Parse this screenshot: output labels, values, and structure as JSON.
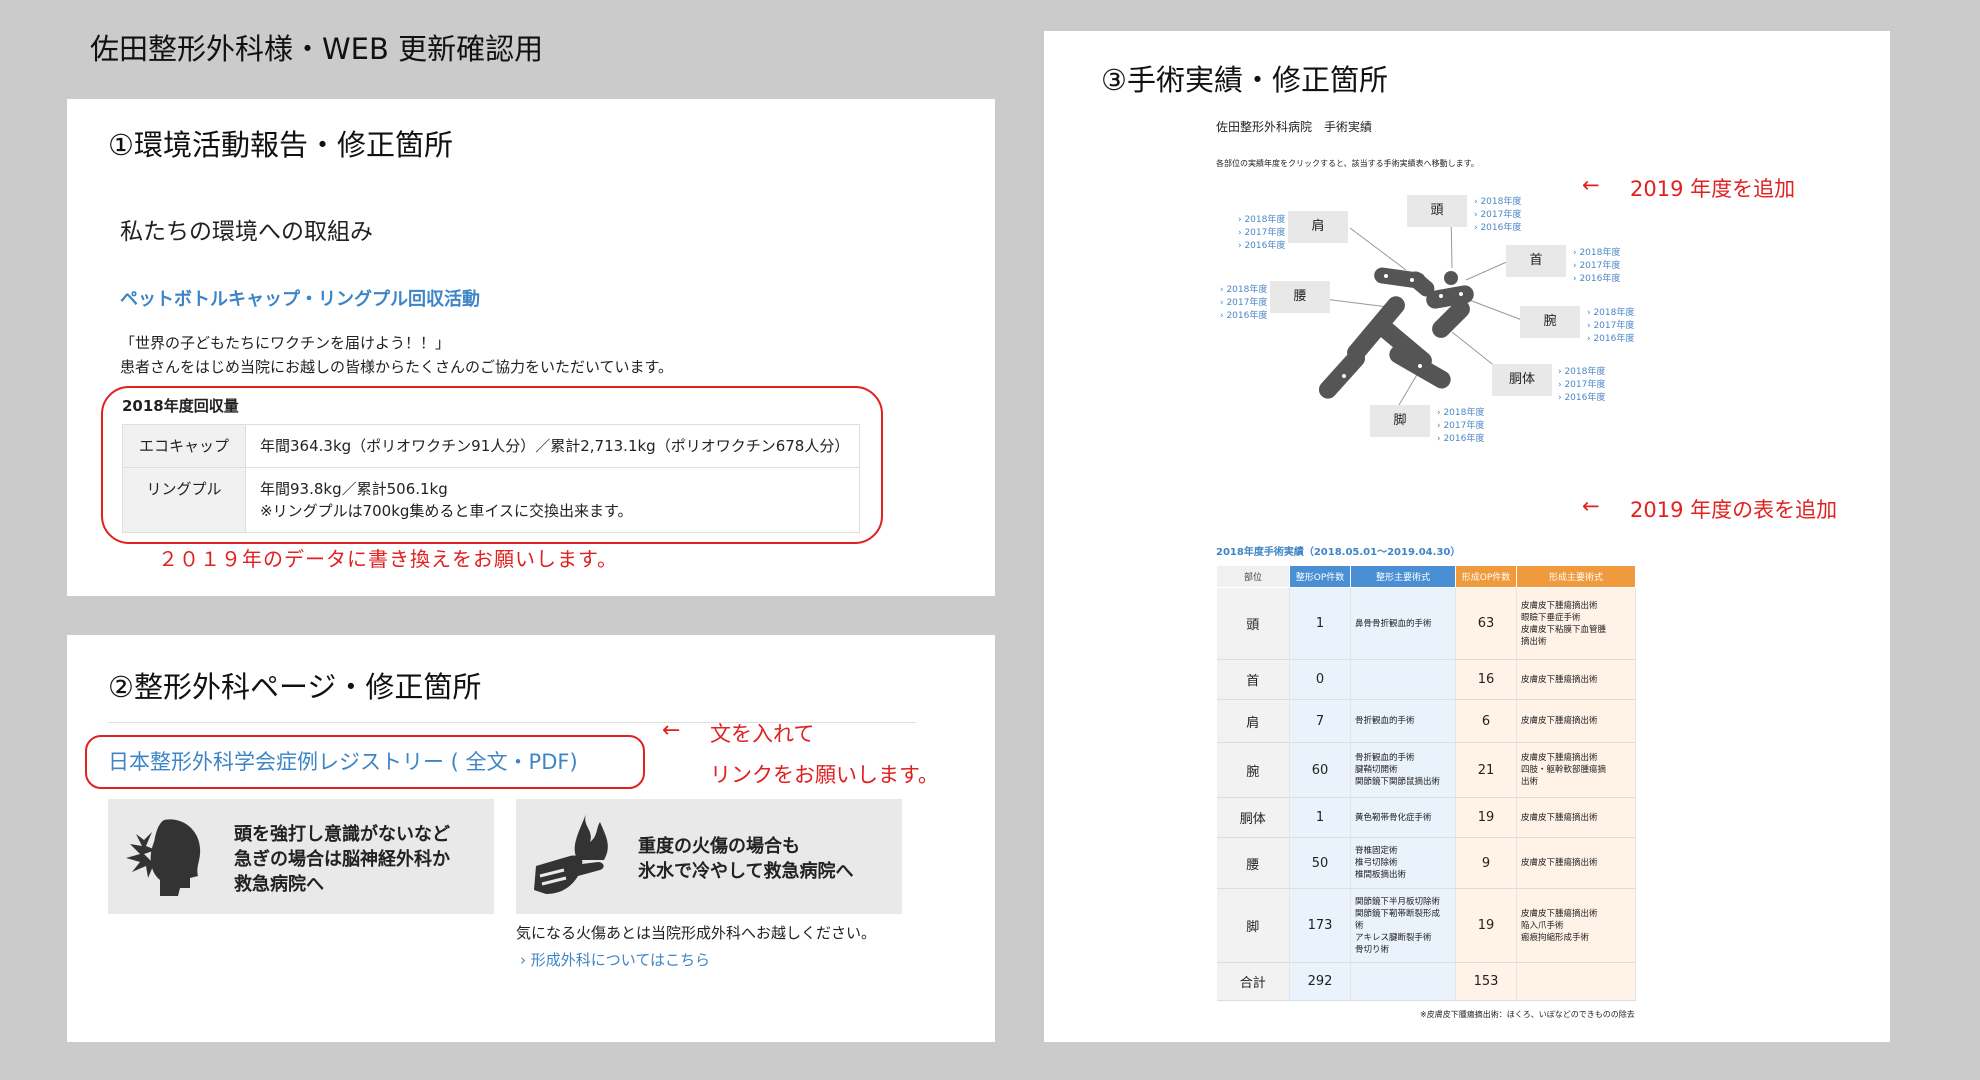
{
  "page_title": "佐田整形外科様・WEB 更新確認用",
  "panel1": {
    "heading": "①環境活動報告・修正箇所",
    "section_title": "私たちの環境への取組み",
    "subheading": "ペットボトルキャップ・リングプル回収活動",
    "intro": [
      "「世界の子どもたちにワクチンを届けよう！！」",
      "患者さんをはじめ当院にお越しの皆様からたくさんのご協力をいただいています。"
    ],
    "table_title": "2018年度回収量",
    "rows": [
      {
        "label": "エコキャップ",
        "lines": [
          "年間364.3kg（ポリオワクチン91人分）／累計2,713.1kg（ポリオワクチン678人分）"
        ]
      },
      {
        "label": "リングプル",
        "lines": [
          "年間93.8kg／累計506.1kg",
          "※リングプルは700kg集めると車イスに交換出来ます。"
        ]
      }
    ],
    "note": "２０１９年のデータに書き換えをお願いします。"
  },
  "panel2": {
    "heading": "②整形外科ページ・修正箇所",
    "link_text": "日本整形外科学会症例レジストリー ( 全文・PDF)",
    "arrow": "←",
    "note_line1": "文を入れて",
    "note_line2": "リンクをお願いします。",
    "card1_text": [
      "頭を強打し意識がないなど",
      "急ぎの場合は脳神経外科か",
      "救急病院へ"
    ],
    "card2_text": [
      "重度の火傷の場合も",
      "氷水で冷やして救急病院へ"
    ],
    "caption": "気になる火傷あとは当院形成外科へお越しください。",
    "caption_link": "› 形成外科についてはこちら",
    "icon1": "head-impact-icon",
    "icon2": "burn-hand-icon"
  },
  "panel3": {
    "heading": "③手術実績・修正箇所",
    "doc_title": "佐田整形外科病院　手術実績",
    "doc_instruction": "各部位の実績年度をクリックすると、該当する手術実績表へ移動します。",
    "arrow": "←",
    "note1": "2019 年度を追加",
    "note2": "2019 年度の表を追加",
    "parts": [
      {
        "name": "肩",
        "years": [
          "› 2018年度",
          "› 2017年度",
          "› 2016年度"
        ]
      },
      {
        "name": "頭",
        "years": [
          "› 2018年度",
          "› 2017年度",
          "› 2016年度"
        ]
      },
      {
        "name": "首",
        "years": [
          "› 2018年度",
          "› 2017年度",
          "› 2016年度"
        ]
      },
      {
        "name": "腰",
        "years": [
          "› 2018年度",
          "› 2017年度",
          "› 2016年度"
        ]
      },
      {
        "name": "腕",
        "years": [
          "› 2018年度",
          "› 2017年度",
          "› 2016年度"
        ]
      },
      {
        "name": "胴体",
        "years": [
          "› 2018年度",
          "› 2017年度",
          "› 2016年度"
        ]
      },
      {
        "name": "脚",
        "years": [
          "› 2018年度",
          "› 2017年度",
          "› 2016年度"
        ]
      }
    ],
    "table_title": "2018年度手術実績（2018.05.01～2019.04.30）",
    "headers": [
      "部位",
      "整形OP件数",
      "整形主要術式",
      "形成OP件数",
      "形成主要術式"
    ],
    "rows": [
      {
        "part": "頭",
        "ortho_count": "1",
        "ortho_proc": [
          "鼻骨骨折観血的手術"
        ],
        "plastic_count": "63",
        "plastic_proc": [
          "皮膚皮下腫瘍摘出術",
          "眼瞼下垂症手術",
          "皮膚皮下粘膜下血管腫",
          "摘出術"
        ]
      },
      {
        "part": "首",
        "ortho_count": "0",
        "ortho_proc": [],
        "plastic_count": "16",
        "plastic_proc": [
          "皮膚皮下腫瘍摘出術"
        ]
      },
      {
        "part": "肩",
        "ortho_count": "7",
        "ortho_proc": [
          "骨折観血的手術"
        ],
        "plastic_count": "6",
        "plastic_proc": [
          "皮膚皮下腫瘍摘出術"
        ]
      },
      {
        "part": "腕",
        "ortho_count": "60",
        "ortho_proc": [
          "骨折観血的手術",
          "腱鞘切開術",
          "関節鏡下関節鼠摘出術"
        ],
        "plastic_count": "21",
        "plastic_proc": [
          "皮膚皮下腫瘍摘出術",
          "四肢・躯幹軟部腫瘍摘",
          "出術"
        ]
      },
      {
        "part": "胴体",
        "ortho_count": "1",
        "ortho_proc": [
          "黄色靭帯骨化症手術"
        ],
        "plastic_count": "19",
        "plastic_proc": [
          "皮膚皮下腫瘍摘出術"
        ]
      },
      {
        "part": "腰",
        "ortho_count": "50",
        "ortho_proc": [
          "脊椎固定術",
          "椎弓切除術",
          "椎間板摘出術"
        ],
        "plastic_count": "9",
        "plastic_proc": [
          "皮膚皮下腫瘍摘出術"
        ]
      },
      {
        "part": "脚",
        "ortho_count": "173",
        "ortho_proc": [
          "関節鏡下半月板切除術",
          "関節鏡下靭帯断裂形成",
          "術",
          "アキレス腱断裂手術",
          "骨切り術"
        ],
        "plastic_count": "19",
        "plastic_proc": [
          "皮膚皮下腫瘍摘出術",
          "陥入爪手術",
          "瘢痕拘縮形成手術"
        ]
      },
      {
        "part": "合計",
        "ortho_count": "292",
        "ortho_proc": [],
        "plastic_count": "153",
        "plastic_proc": []
      }
    ],
    "footnote": "※皮膚皮下腫瘍摘出術：ほくろ、いぼなどのできものの除去",
    "header_colors": {
      "neutral": "#f0f0f0",
      "ortho": "#4a8fd4",
      "plastic": "#ef9a3c"
    },
    "figure_color": "#555555"
  },
  "colors": {
    "accent_red": "#e12020",
    "link_blue": "#3d85c6"
  }
}
